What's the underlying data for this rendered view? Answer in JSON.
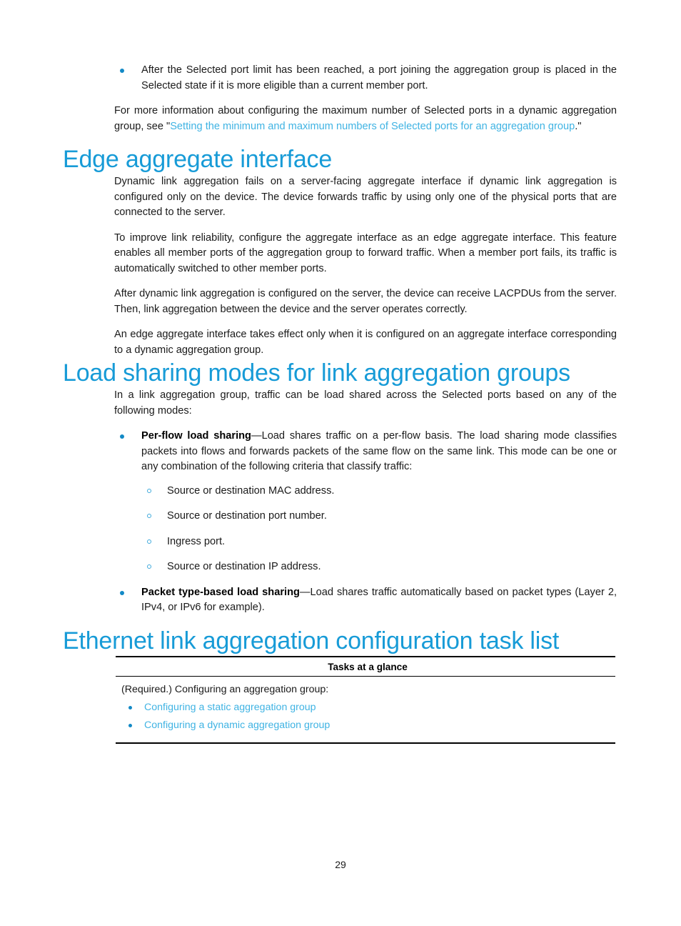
{
  "document": {
    "page_number": "29",
    "colors": {
      "heading": "#179BD7",
      "link": "#3FB3E3",
      "bullet": "#1289C6",
      "text": "#1a1a1a",
      "rule": "#000000"
    }
  },
  "top_section": {
    "bullets": [
      "After the Selected port limit has been reached, a port joining the aggregation group is placed in the Selected state if it is more eligible than a current member port."
    ],
    "paragraph_prefix": "For more information about configuring the maximum number of Selected ports in a dynamic aggregation group, see \"",
    "paragraph_link": "Setting the minimum and maximum numbers of Selected ports for an aggregation group",
    "paragraph_suffix": ".\""
  },
  "edge_section": {
    "heading": "Edge aggregate interface",
    "paragraphs": [
      "Dynamic link aggregation fails on a server-facing aggregate interface if dynamic link aggregation is configured only on the device. The device forwards traffic by using only one of the physical ports that are connected to the server.",
      "To improve link reliability, configure the aggregate interface as an edge aggregate interface. This feature enables all member ports of the aggregation group to forward traffic. When a member port fails, its traffic is automatically switched to other member ports.",
      "After dynamic link aggregation is configured on the server, the device can receive LACPDUs from the server. Then, link aggregation between the device and the server operates correctly.",
      "An edge aggregate interface takes effect only when it is configured on an aggregate interface corresponding to a dynamic aggregation group."
    ]
  },
  "load_sharing_section": {
    "heading": "Load sharing modes for link aggregation groups",
    "intro": "In a link aggregation group, traffic can be load shared across the Selected ports based on any of the following modes:",
    "modes": [
      {
        "term": "Per-flow load sharing",
        "dash": "—",
        "description": "Load shares traffic on a per-flow basis. The load sharing mode classifies packets into flows and forwards packets of the same flow on the same link. This mode can be one or any combination of the following criteria that classify traffic:",
        "criteria": [
          "Source or destination MAC address.",
          "Source or destination port number.",
          "Ingress port.",
          "Source or destination IP address."
        ]
      },
      {
        "term": "Packet type-based load sharing",
        "dash": "—",
        "description": "Load shares traffic automatically based on packet types (Layer 2, IPv4, or IPv6 for example).",
        "criteria": []
      }
    ]
  },
  "task_list_section": {
    "heading": "Ethernet link aggregation configuration task list",
    "table": {
      "header": "Tasks at a glance",
      "row_intro": "(Required.) Configuring an aggregation group:",
      "links": [
        "Configuring a static aggregation group",
        "Configuring a dynamic aggregation group"
      ]
    }
  }
}
